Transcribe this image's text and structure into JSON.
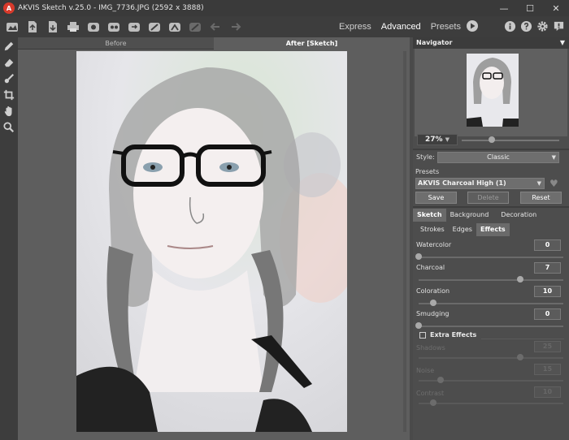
{
  "title": "AKVIS Sketch v.25.0 - IMG_7736.JPG (2592 x 3888)",
  "window_controls": [
    "minimize-icon",
    "maximize-icon",
    "close-icon"
  ],
  "toolbar": {
    "icons": [
      "home-icon",
      "open-icon",
      "save-icon",
      "print-icon",
      "share-icon",
      "batch-icon",
      "export-icon",
      "brush-icon",
      "settings-icon",
      "undo-disabled-icon",
      "back-icon",
      "forward-icon"
    ],
    "modes": [
      "Express",
      "Advanced",
      "Presets"
    ],
    "active_mode": "Advanced",
    "right_icons": [
      "run-icon",
      "info-icon",
      "help-icon",
      "gear-icon",
      "notification-icon"
    ]
  },
  "tools": [
    "pencil-icon",
    "eraser-icon",
    "brush-icon",
    "crop-icon",
    "hand-icon",
    "zoom-icon"
  ],
  "canvas": {
    "tabs": [
      "Before",
      "After [Sketch]"
    ],
    "active_tab": "After [Sketch]"
  },
  "panel": {
    "navigator_title": "Navigator",
    "zoom": "27%",
    "zoom_fraction": 0.31,
    "style_label": "Style:",
    "style_value": "Classic",
    "presets_label": "Presets",
    "preset_value": "AKVIS Charcoal High (1)",
    "buttons": [
      "Save",
      "Delete",
      "Reset"
    ],
    "main_tabs": [
      "Sketch",
      "Background",
      "Decoration"
    ],
    "active_main_tab": "Sketch",
    "sub_tabs": [
      "Strokes",
      "Edges",
      "Effects"
    ],
    "active_sub_tab": "Effects",
    "params": [
      {
        "label": "Watercolor",
        "value": "0",
        "fraction": 0.0,
        "disabled": false
      },
      {
        "label": "Charcoal",
        "value": "7",
        "fraction": 0.7,
        "disabled": false
      },
      {
        "label": "Coloration",
        "value": "10",
        "fraction": 0.1,
        "disabled": false
      },
      {
        "label": "Smudging",
        "value": "0",
        "fraction": 0.0,
        "disabled": false
      }
    ],
    "extra_label": "Extra Effects",
    "extra_params": [
      {
        "label": "Shadows",
        "value": "25",
        "fraction": 0.7,
        "disabled": true
      },
      {
        "label": "Noise",
        "value": "15",
        "fraction": 0.15,
        "disabled": true
      },
      {
        "label": "Contrast",
        "value": "10",
        "fraction": 0.1,
        "disabled": true
      }
    ]
  },
  "colors": {
    "background": "#4a4a4a",
    "panel": "#4d4d4d",
    "canvas": "#5e5e5e",
    "accent_logo": "#d93a2b"
  }
}
